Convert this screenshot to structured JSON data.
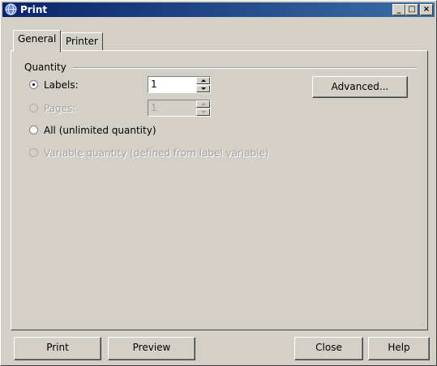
{
  "window": {
    "title": "Print",
    "controls": [
      "_",
      "□",
      "×"
    ]
  },
  "tabs": [
    {
      "label": "General",
      "active": true
    },
    {
      "label": "Printer",
      "active": false
    }
  ],
  "quantity": {
    "group_label": "Quantity",
    "labels_option": {
      "label": "Labels:",
      "value": "1",
      "selected": true,
      "enabled": true
    },
    "pages_option": {
      "label": "Pages:",
      "value": "1",
      "selected": false,
      "enabled": false
    },
    "all_option": {
      "label": "All (unlimited quantity)",
      "selected": false,
      "enabled": true
    },
    "variable_option": {
      "label": "Variable quantity (defined from label variable)",
      "selected": false,
      "enabled": false
    }
  },
  "advanced_button": "Advanced...",
  "footer": {
    "print": "Print",
    "preview": "Preview",
    "close": "Close",
    "help": "Help"
  },
  "colors": {
    "face": "#d4d0c8",
    "title_start": "#0a246a",
    "title_end": "#3a6ea5",
    "disabled_text": "#a0a0a0"
  },
  "icons": {
    "app": "printer-globe-icon"
  }
}
